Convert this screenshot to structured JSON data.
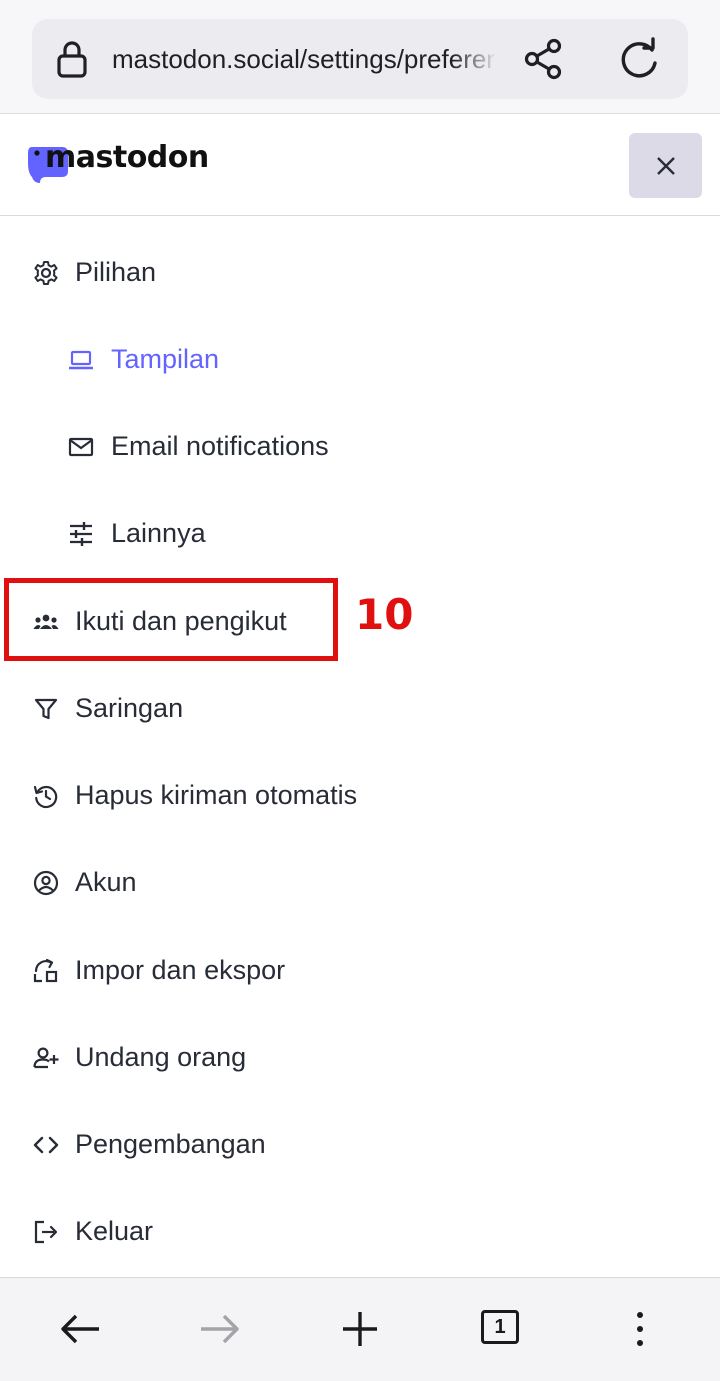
{
  "browser": {
    "url": "mastodon.social/settings/preferences/appearance",
    "icons": [
      "lock-icon",
      "share-icon",
      "reload-icon"
    ]
  },
  "site": {
    "logo_text": "mastodon",
    "close_icon": "close-icon",
    "accent_color": "#6364ff"
  },
  "menu": {
    "items": [
      {
        "label": "Pilihan",
        "icon": "gear-icon",
        "level": "top"
      },
      {
        "label": "Tampilan",
        "icon": "laptop-icon",
        "level": "sub",
        "active": true
      },
      {
        "label": "Email notifications",
        "icon": "mail-icon",
        "level": "sub"
      },
      {
        "label": "Lainnya",
        "icon": "sliders-icon",
        "level": "sub"
      },
      {
        "label": "Ikuti dan pengikut",
        "icon": "people-icon",
        "level": "top"
      },
      {
        "label": "Saringan",
        "icon": "filter-icon",
        "level": "top"
      },
      {
        "label": "Hapus kiriman otomatis",
        "icon": "history-icon",
        "level": "top"
      },
      {
        "label": "Akun",
        "icon": "account-icon",
        "level": "top"
      },
      {
        "label": "Impor dan ekspor",
        "icon": "import-export-icon",
        "level": "top"
      },
      {
        "label": "Undang orang",
        "icon": "person-add-icon",
        "level": "top"
      },
      {
        "label": "Pengembangan",
        "icon": "code-icon",
        "level": "top"
      },
      {
        "label": "Keluar",
        "icon": "logout-icon",
        "level": "top"
      }
    ]
  },
  "annotation": {
    "number": "10",
    "color": "#e01010"
  },
  "bottom_nav": {
    "tab_count": "1",
    "icons": [
      "back-arrow-icon",
      "forward-arrow-icon",
      "new-tab-icon",
      "tabs-icon",
      "more-menu-icon"
    ]
  }
}
